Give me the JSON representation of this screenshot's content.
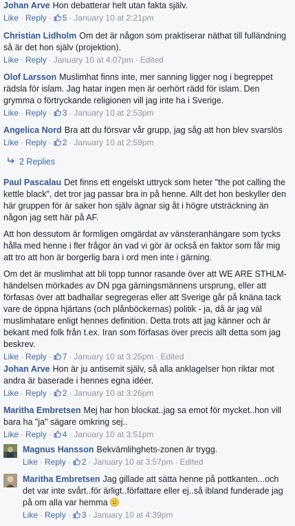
{
  "labels": {
    "like": "Like",
    "reply": "Reply",
    "dot": "·"
  },
  "comments": [
    {
      "author": "Johan Arve",
      "text": "Hon debatterar helt utan fakta själv.",
      "likes": "5",
      "time": "January 10 at 2:21pm",
      "edited": ""
    },
    {
      "author": "Christian Lidholm",
      "text": "Om det är någon som praktiserar näthat till fulländning så är det hon själv (projektion).",
      "likes": "",
      "time": "January 10 at 4:07pm",
      "edited": "Edited"
    },
    {
      "author": "Olof Larsson",
      "text": "Muslimhat finns inte, mer sanning ligger nog i begreppet rädsla för islam. Jag hatar ingen men är oerhört rädd för islam. Den grymma o förtryckande religionen vill jag inte ha i Sverige.",
      "likes": "3",
      "time": "January 10 at 2:53pm",
      "edited": ""
    },
    {
      "author": "Angelica Nord",
      "text": "Bra att du försvar vår grupp, jag såg att hon blev svarslös",
      "likes": "2",
      "time": "January 10 at 2:59pm",
      "edited": ""
    },
    {
      "author": "Paul Pascalau",
      "paragraphs": [
        "Det finns ett engelskt uttryck som heter \"the pot calling the kettle black\", det tror jag passar bra in på henne. Allt det hon beskyller den här gruppen för är saker hon själv ägnar sig åt i högre utsträckning än någon jag sett här på AF.",
        "Att hon dessutom är formligen omgärdat av vänsteranhängare som tycks hålla med henne i fler frågor än vad vi gör är också en faktor som får mig att tro att hon är borgerlig bara i ord men inte i gärning.",
        "Om det är muslimhat att bli topp tunnor rasande över att WE ARE STHLM-händelsen mörkades av DN pga gärningsmännens ursprung, eller att förfasas över att badhallar segregeras eller att Sverige går på knäna tack vare de öppna hjärtans (och plånböckernas) politik - ja, då är jag väl muslimhatare enligt hennes definition. Detta trots att jag känner och är bekant med folk från t.ex. Iran som förfasas över precis allt detta som jag beskrev."
      ],
      "likes": "7",
      "time": "January 10 at 3:25pm",
      "edited": "Edited"
    },
    {
      "author": "Johan Arve",
      "text": "Hon är ju antisemit själv, så alla anklagelser hon riktar mot andra är baserade i hennes egna idéer.",
      "likes": "2",
      "time": "January 10 at 3:26pm",
      "edited": ""
    },
    {
      "author": "Maritha Embretsen",
      "text": "Mej har hon blockat..jag sa emot för mycket..hon vill bara ha \"ja\" sägare omkring sej..",
      "likes": "4",
      "time": "January 10 at 3:51pm",
      "edited": ""
    }
  ],
  "replies_link": "2 Replies",
  "replies": [
    {
      "author": "Magnus Hansson",
      "text": "Bekvämlihghets-zonen är trygg.",
      "likes": "2",
      "time": "January 10 at 3:57pm",
      "edited": "Edited"
    },
    {
      "author": "Maritha Embretsen",
      "text": "Jag gillade att sätta henne på pottkanten...och det var inte svårt..för ärligt..författare eller ej..så ibland funderade jag på om alla var hemma",
      "emoji": "smiley-emoji",
      "likes": "3",
      "time": "January 10 at 4:39pm",
      "edited": ""
    }
  ],
  "colors": {
    "author": "#365899",
    "link": "#4267b2",
    "meta": "#90949c",
    "background": "#f6f7f9"
  }
}
